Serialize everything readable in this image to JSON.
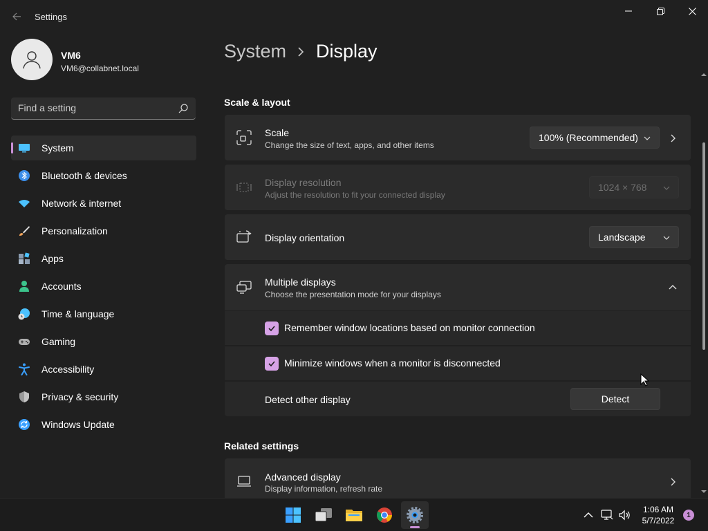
{
  "window": {
    "title": "Settings"
  },
  "user": {
    "name": "VM6",
    "email": "VM6@collabnet.local"
  },
  "search": {
    "placeholder": "Find a setting"
  },
  "nav": {
    "items": [
      {
        "label": "System",
        "icon": "monitor-icon",
        "color": "#4cc2ff",
        "active": true
      },
      {
        "label": "Bluetooth & devices",
        "icon": "bluetooth-icon",
        "color": "#3b8eea"
      },
      {
        "label": "Network & internet",
        "icon": "wifi-icon",
        "color": "#4cc2ff"
      },
      {
        "label": "Personalization",
        "icon": "paintbrush-icon",
        "color": "#f0a35a"
      },
      {
        "label": "Apps",
        "icon": "apps-icon",
        "color": "#8a9bb0"
      },
      {
        "label": "Accounts",
        "icon": "person-icon",
        "color": "#3cc48c"
      },
      {
        "label": "Time & language",
        "icon": "globe-clock-icon",
        "color": "#4cc2ff"
      },
      {
        "label": "Gaming",
        "icon": "gamepad-icon",
        "color": "#b0b0b0"
      },
      {
        "label": "Accessibility",
        "icon": "accessibility-icon",
        "color": "#3aa0ff"
      },
      {
        "label": "Privacy & security",
        "icon": "shield-icon",
        "color": "#9a9a9a"
      },
      {
        "label": "Windows Update",
        "icon": "update-icon",
        "color": "#3aa0ff"
      }
    ]
  },
  "breadcrumb": {
    "parent": "System",
    "current": "Display"
  },
  "scale_layout": {
    "section_title": "Scale & layout",
    "scale": {
      "title": "Scale",
      "desc": "Change the size of text, apps, and other items",
      "value": "100% (Recommended)"
    },
    "resolution": {
      "title": "Display resolution",
      "desc": "Adjust the resolution to fit your connected display",
      "value": "1024 × 768"
    },
    "orientation": {
      "title": "Display orientation",
      "value": "Landscape"
    },
    "multiple": {
      "title": "Multiple displays",
      "desc": "Choose the presentation mode for your displays",
      "remember_label": "Remember window locations based on monitor connection",
      "remember_checked": true,
      "minimize_label": "Minimize windows when a monitor is disconnected",
      "minimize_checked": true,
      "detect_label": "Detect other display",
      "detect_button": "Detect"
    }
  },
  "related": {
    "section_title": "Related settings",
    "advanced": {
      "title": "Advanced display",
      "desc": "Display information, refresh rate"
    }
  },
  "taskbar": {
    "time": "1:06 AM",
    "date": "5/7/2022",
    "notifications": "1",
    "accent": "#c98fd6"
  }
}
